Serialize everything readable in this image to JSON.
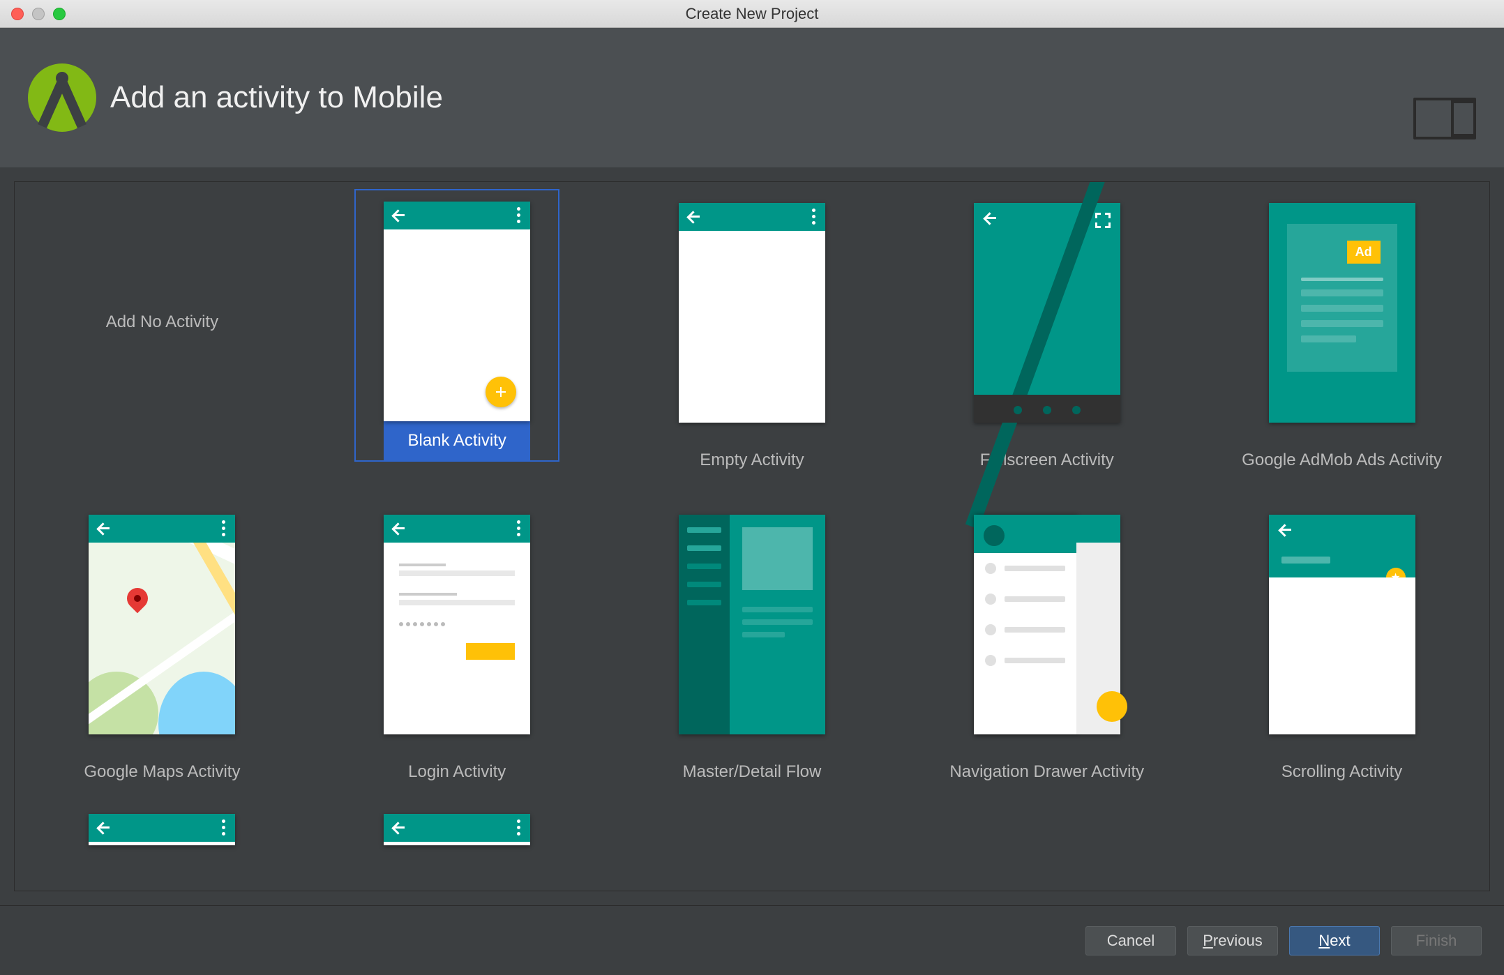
{
  "window": {
    "title": "Create New Project"
  },
  "header": {
    "title": "Add an activity to Mobile"
  },
  "templates": [
    {
      "id": "no-activity",
      "label": "Add No Activity",
      "selected": false,
      "previewType": "none"
    },
    {
      "id": "blank-activity",
      "label": "Blank Activity",
      "selected": true,
      "previewType": "blank"
    },
    {
      "id": "empty-activity",
      "label": "Empty Activity",
      "selected": false,
      "previewType": "empty"
    },
    {
      "id": "fullscreen-activity",
      "label": "Fullscreen Activity",
      "selected": false,
      "previewType": "fullscreen"
    },
    {
      "id": "admob-activity",
      "label": "Google AdMob Ads Activity",
      "selected": false,
      "previewType": "admob",
      "adBadge": "Ad"
    },
    {
      "id": "maps-activity",
      "label": "Google Maps Activity",
      "selected": false,
      "previewType": "maps"
    },
    {
      "id": "login-activity",
      "label": "Login Activity",
      "selected": false,
      "previewType": "login"
    },
    {
      "id": "master-detail-flow",
      "label": "Master/Detail Flow",
      "selected": false,
      "previewType": "masterdetail"
    },
    {
      "id": "nav-drawer-activity",
      "label": "Navigation Drawer Activity",
      "selected": false,
      "previewType": "navdrawer"
    },
    {
      "id": "scrolling-activity",
      "label": "Scrolling Activity",
      "selected": false,
      "previewType": "scrolling"
    }
  ],
  "partialRowTemplates": [
    {
      "id": "partial-1",
      "previewType": "appbar-only"
    },
    {
      "id": "partial-2",
      "previewType": "appbar-only"
    }
  ],
  "footer": {
    "cancel": "Cancel",
    "previous_prefix": "P",
    "previous_rest": "revious",
    "next_prefix": "N",
    "next_rest": "ext",
    "finish": "Finish"
  }
}
